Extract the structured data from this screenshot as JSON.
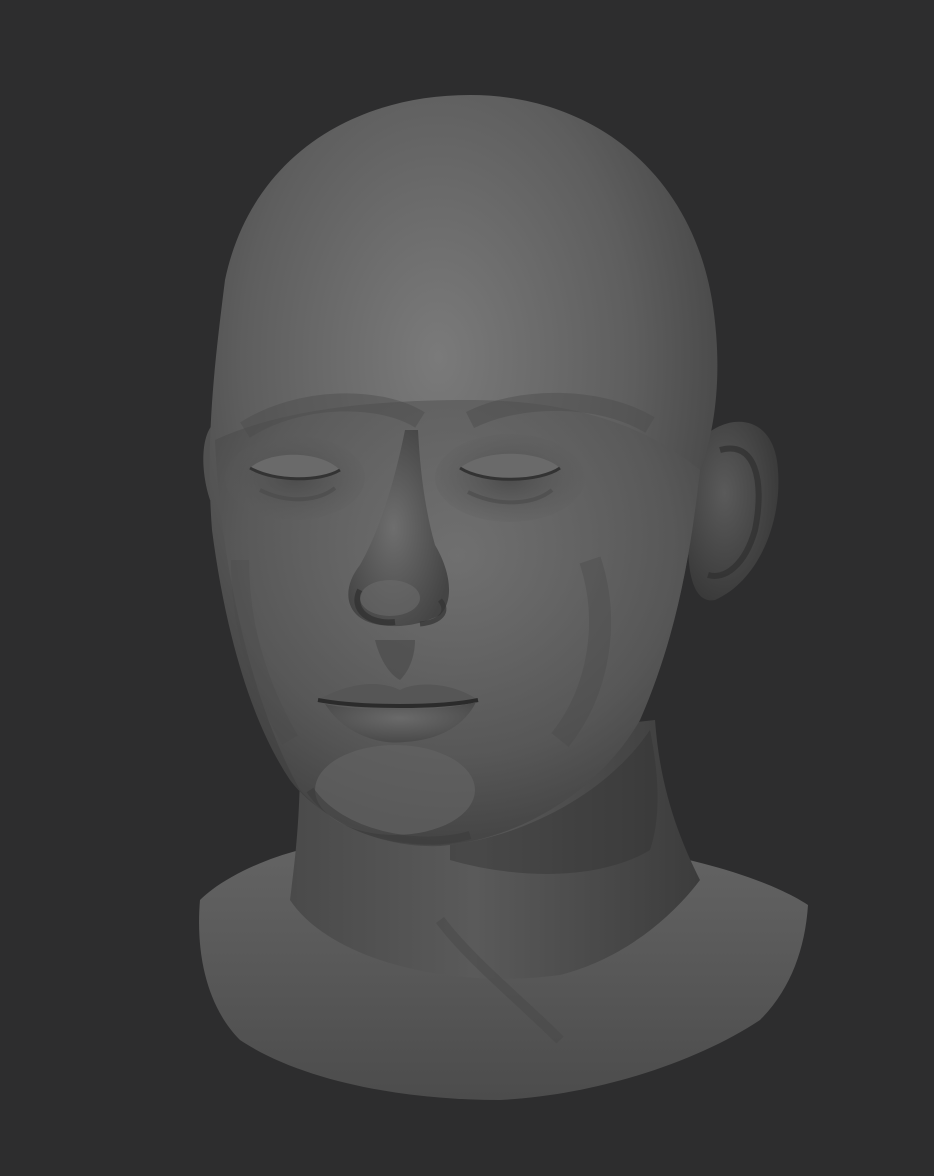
{
  "scene": {
    "subject": "sculpted-head-render",
    "colors": {
      "background": "#2d2d2e",
      "clay_light": "#7b7b7b",
      "clay_mid": "#5c5c5c",
      "clay_dark": "#393939",
      "shadow": "#252525"
    }
  }
}
